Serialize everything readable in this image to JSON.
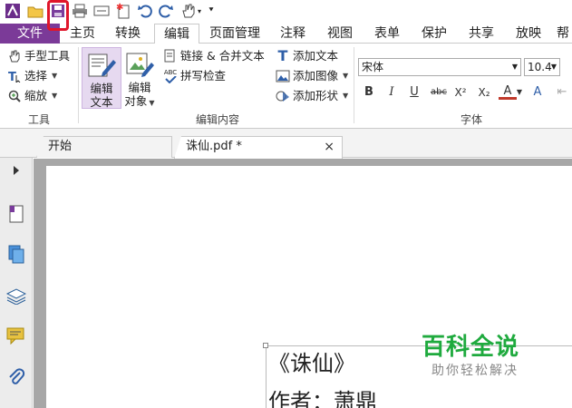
{
  "quick_access": {
    "icons": [
      "app-logo-icon",
      "open-folder-icon",
      "save-icon",
      "print-icon",
      "screen-icon",
      "new-file-star-icon",
      "undo-icon",
      "redo-icon",
      "hand-tool-icon",
      "customize-dropdown-icon"
    ]
  },
  "tabs": [
    {
      "label": "文件"
    },
    {
      "label": "主页"
    },
    {
      "label": "转换"
    },
    {
      "label": "编辑"
    },
    {
      "label": "页面管理"
    },
    {
      "label": "注释"
    },
    {
      "label": "视图"
    },
    {
      "label": "表单"
    },
    {
      "label": "保护"
    },
    {
      "label": "共享"
    },
    {
      "label": "放映"
    },
    {
      "label": "帮"
    }
  ],
  "ribbon": {
    "tools_group": {
      "items": [
        "手型工具",
        "选择",
        "缩放"
      ],
      "label": "工具"
    },
    "edit_group": {
      "edit_text": "编辑\n文本",
      "edit_text_l1": "编辑",
      "edit_text_l2": "文本",
      "edit_object_l1": "编辑",
      "edit_object_l2": "对象",
      "link_merge": "链接 & 合并文本",
      "spellcheck": "拼写检查",
      "spell_abc": "ABC",
      "add_text": "添加文本",
      "add_image": "添加图像",
      "add_shape": "添加形状",
      "label": "编辑内容"
    },
    "font_group": {
      "font_name": "宋体",
      "font_size": "10.4",
      "format_buttons": [
        "B",
        "I",
        "U",
        "abc",
        "X²",
        "X₂",
        "A",
        "A"
      ],
      "label": "字体"
    }
  },
  "doc_tabs": [
    {
      "label": "开始"
    },
    {
      "label": "诛仙.pdf *",
      "close": "×"
    }
  ],
  "sidebar_icons": [
    "expand-arrow-icon",
    "page-thumbnail-icon",
    "pages-icon",
    "layers-icon",
    "comments-icon",
    "attachment-icon"
  ],
  "document": {
    "line1": "《诛仙》",
    "line2": "作者：萧鼎"
  },
  "watermark": {
    "title": "百科全说",
    "subtitle": "助你轻松解决"
  },
  "colors": {
    "file_tab": "#7b3a98",
    "highlight": "#e0162b",
    "watermark": "#1faa3e"
  }
}
